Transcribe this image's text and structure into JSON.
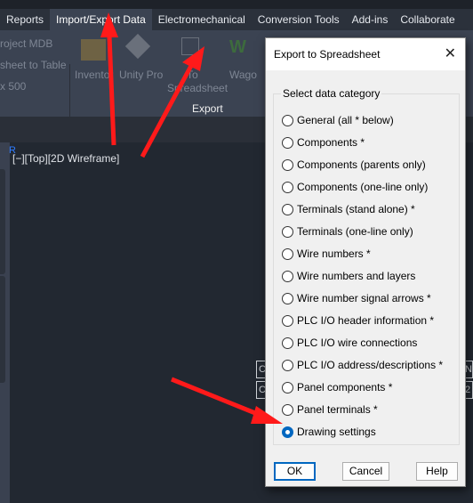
{
  "ribbon": {
    "tabs": [
      {
        "label": "Reports",
        "active": false
      },
      {
        "label": "Import/Export Data",
        "active": true
      },
      {
        "label": "Electromechanical",
        "active": false
      },
      {
        "label": "Conversion Tools",
        "active": false
      },
      {
        "label": "Add-ins",
        "active": false
      },
      {
        "label": "Collaborate",
        "active": false
      }
    ],
    "left_items": [
      "roject MDB",
      "sheet to Table",
      "x 500"
    ],
    "buttons": [
      {
        "label": "Inventor",
        "icon": "inventor-icon"
      },
      {
        "label": "Unity Pro",
        "icon": "unity-pro-icon"
      },
      {
        "label": "To Spreadsheet",
        "line1": "To",
        "line2": "Spreadsheet",
        "icon": "spreadsheet-export-icon"
      },
      {
        "label": "Wago",
        "icon": "wago-icon"
      }
    ],
    "panel_label": "Export"
  },
  "viewport": {
    "label": "[−][Top][2D Wireframe]",
    "ucs": "R"
  },
  "side_cells": [
    "C",
    "C",
    "N",
    "2"
  ],
  "dialog": {
    "title": "Export to Spreadsheet",
    "group_label": "Select data category",
    "options": [
      {
        "label": "General (all * below)",
        "selected": false
      },
      {
        "label": "Components *",
        "selected": false
      },
      {
        "label": "Components (parents only)",
        "selected": false
      },
      {
        "label": "Components (one-line only)",
        "selected": false
      },
      {
        "label": "Terminals (stand alone) *",
        "selected": false
      },
      {
        "label": "Terminals (one-line only)",
        "selected": false
      },
      {
        "label": "Wire numbers *",
        "selected": false
      },
      {
        "label": "Wire numbers and layers",
        "selected": false
      },
      {
        "label": "Wire number signal arrows *",
        "selected": false
      },
      {
        "label": "PLC I/O header information *",
        "selected": false
      },
      {
        "label": "PLC I/O wire connections",
        "selected": false
      },
      {
        "label": "PLC I/O address/descriptions *",
        "selected": false
      },
      {
        "label": "Panel components *",
        "selected": false
      },
      {
        "label": "Panel terminals *",
        "selected": false
      },
      {
        "label": "Drawing settings",
        "selected": true
      }
    ],
    "ok": "OK",
    "cancel": "Cancel",
    "help": "Help"
  },
  "colors": {
    "annotation_arrow": "#ff1a1a",
    "accent": "#0067c0"
  }
}
